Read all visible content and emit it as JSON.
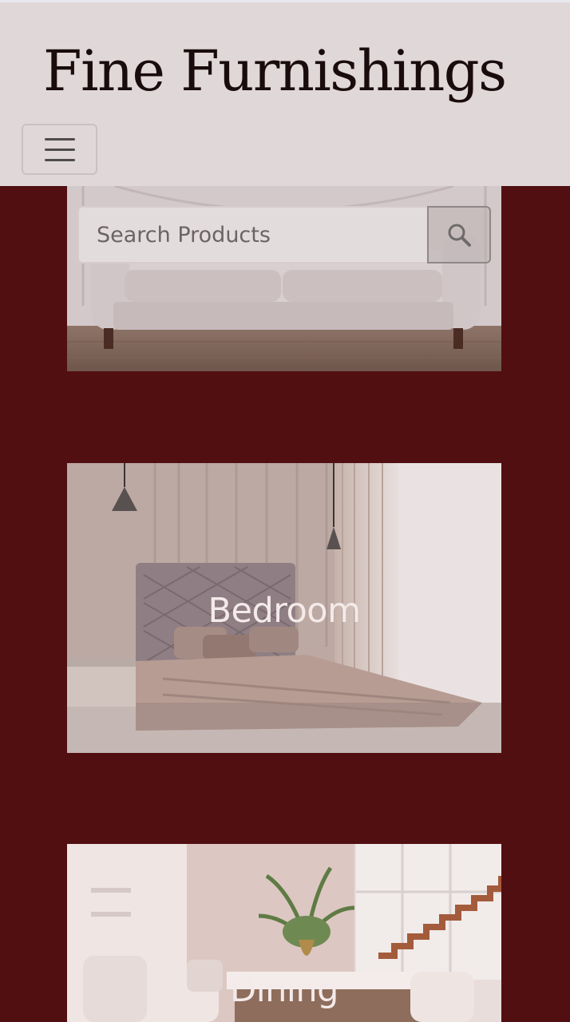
{
  "header": {
    "brand": "Fine Furnishings",
    "menu_icon": "hamburger-icon"
  },
  "search": {
    "placeholder": "Search Products",
    "button_icon": "search-icon"
  },
  "categories": [
    {
      "label": ""
    },
    {
      "label": "Bedroom"
    },
    {
      "label": "Dining"
    }
  ],
  "colors": {
    "background": "#520f12",
    "header_background": "#e0d7d8",
    "brand_text": "#1a0c0c",
    "card_label_text": "#f4eaea"
  }
}
